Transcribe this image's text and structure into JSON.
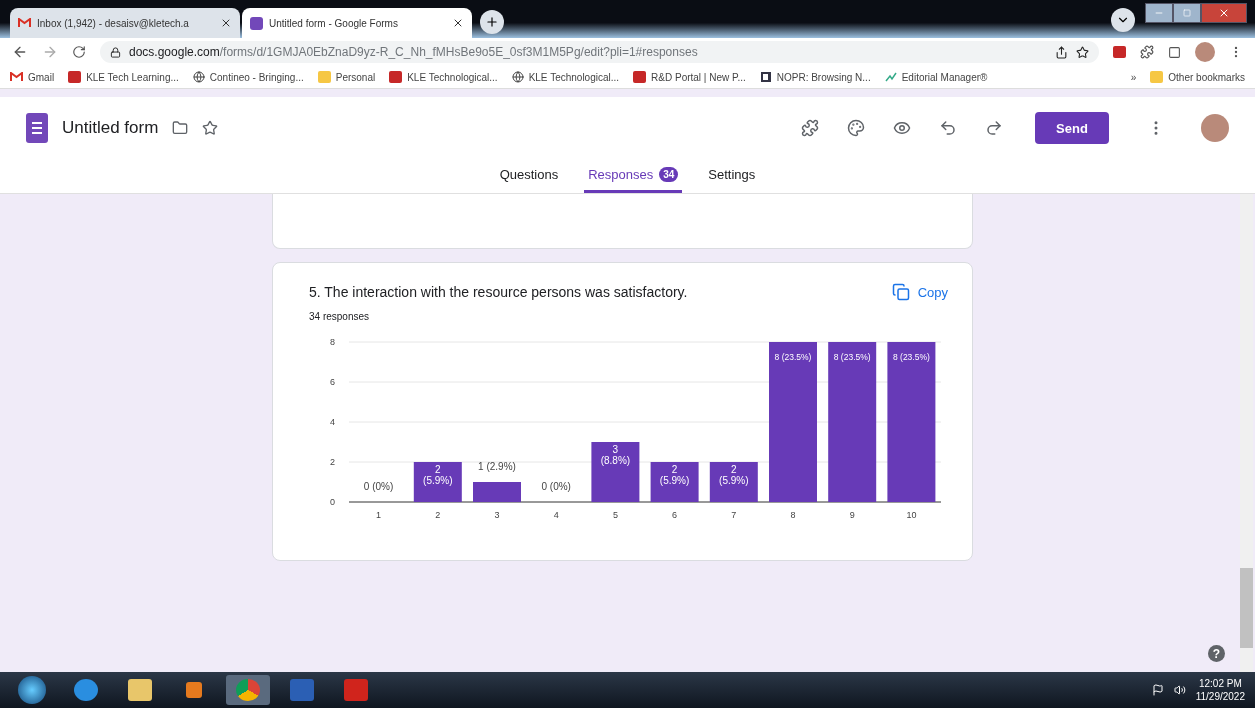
{
  "browser_tabs": [
    {
      "title": "Inbox (1,942) - desaisv@kletech.a",
      "selected": false
    },
    {
      "title": "Untitled form - Google Forms",
      "selected": true
    }
  ],
  "address_bar": {
    "url_host": "docs.google.com",
    "url_path": "/forms/d/1GMJA0EbZnaD9yz-R_C_Nh_fMHsBe9o5E_0sf3M1M5Pg/edit?pli=1#responses"
  },
  "bookmarks": [
    {
      "label": "Gmail"
    },
    {
      "label": "KLE Tech Learning..."
    },
    {
      "label": "Contineo - Bringing..."
    },
    {
      "label": "Personal"
    },
    {
      "label": "KLE Technological..."
    },
    {
      "label": "KLE Technological..."
    },
    {
      "label": "R&D Portal | New P..."
    },
    {
      "label": "NOPR: Browsing N..."
    },
    {
      "label": "Editorial Manager®"
    }
  ],
  "bookmarks_more": "»",
  "other_bookmarks": "Other bookmarks",
  "form_header": {
    "title": "Untitled form",
    "send": "Send"
  },
  "form_tabs": [
    {
      "label": "Questions",
      "selected": false
    },
    {
      "label": "Responses",
      "selected": true,
      "badge": "34"
    },
    {
      "label": "Settings",
      "selected": false
    }
  ],
  "question": {
    "title": "5. The interaction with the resource persons was satisfactory.",
    "copy": "Copy",
    "responses": "34 responses",
    "chart_data": {
      "type": "bar",
      "categories": [
        "1",
        "2",
        "3",
        "4",
        "5",
        "6",
        "7",
        "8",
        "9",
        "10"
      ],
      "values": [
        0,
        2,
        1,
        0,
        3,
        2,
        2,
        8,
        8,
        8
      ],
      "ylim": [
        0,
        8
      ],
      "yticks": [
        0,
        2,
        4,
        6,
        8
      ],
      "grid": true,
      "value_labels": [
        "0 (0%)",
        "2 (5.9%)",
        "1 (2.9%)",
        "0 (0%)",
        "3 (8.8%)",
        "2 (5.9%)",
        "2 (5.9%)",
        "8 (23.5%)",
        "8 (23.5%)",
        "8 (23.5%)"
      ],
      "color": "#673ab7"
    }
  },
  "help": "?",
  "clock": {
    "time": "12:02 PM",
    "date": "11/29/2022"
  }
}
